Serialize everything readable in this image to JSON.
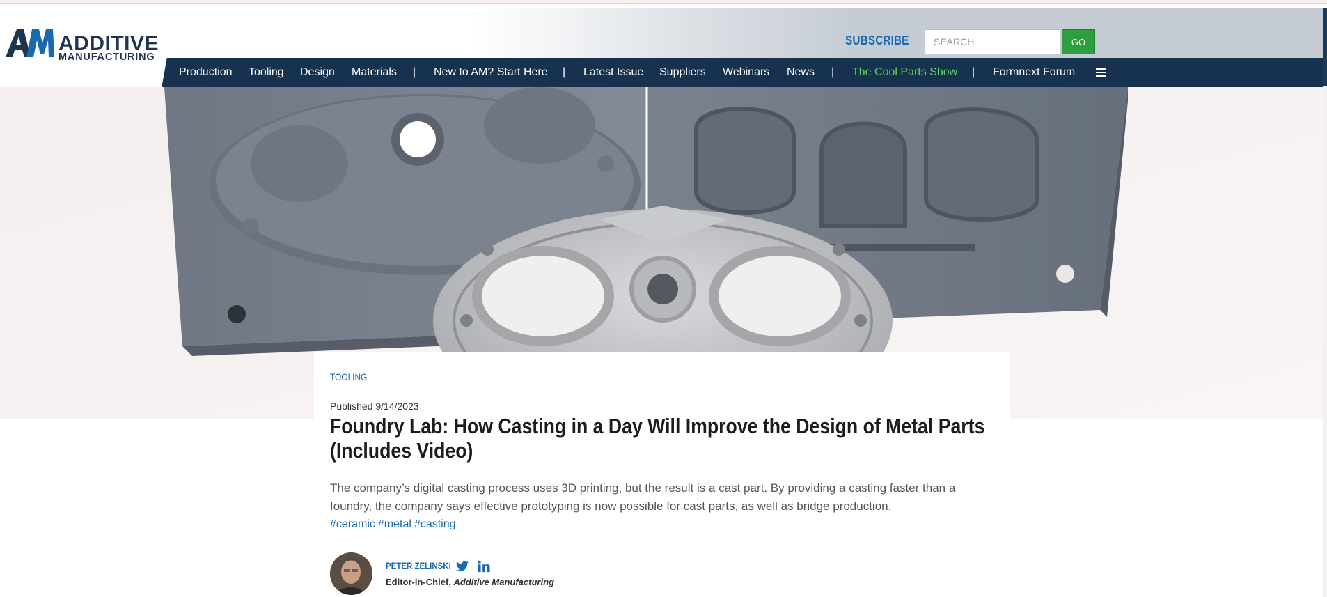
{
  "colors": {
    "brand_navy": "#16324e",
    "link_blue": "#1869b0",
    "go_green": "#2e9e3e",
    "highlight_green": "#5fd35f"
  },
  "logo": {
    "mark": "AM",
    "line1": "ADDITIVE",
    "line2": "MANUFACTURING"
  },
  "header": {
    "subscribe_label": "SUBSCRIBE",
    "search_placeholder": "SEARCH",
    "go_label": "GO"
  },
  "nav": {
    "items": [
      "Production",
      "Tooling",
      "Design",
      "Materials",
      "New to AM? Start Here",
      "Latest Issue",
      "Suppliers",
      "Webinars",
      "News",
      "The Cool Parts Show",
      "Formnext Forum"
    ],
    "separator": "|",
    "menu_icon": "hamburger-menu-icon"
  },
  "hero": {
    "image": "photo-3d-printed-sand-mold-halves-and-cast-aluminum-part"
  },
  "article": {
    "category": "TOOLING",
    "published": "Published 9/14/2023",
    "title": "Foundry Lab: How Casting in a Day Will Improve the Design of Metal Parts (Includes Video)",
    "summary": "The company’s digital casting process uses 3D printing, but the result is a cast part. By providing a casting faster than a foundry, the company says effective prototyping is now possible for cast parts, as well as bridge production.",
    "tags": [
      "#ceramic",
      "#metal",
      "#casting"
    ]
  },
  "author": {
    "name": "PETER ZELINSKI",
    "role_prefix": "Editor-in-Chief, ",
    "role_publication": "Additive Manufacturing",
    "social_icons": [
      "twitter-icon",
      "linkedin-icon"
    ]
  }
}
